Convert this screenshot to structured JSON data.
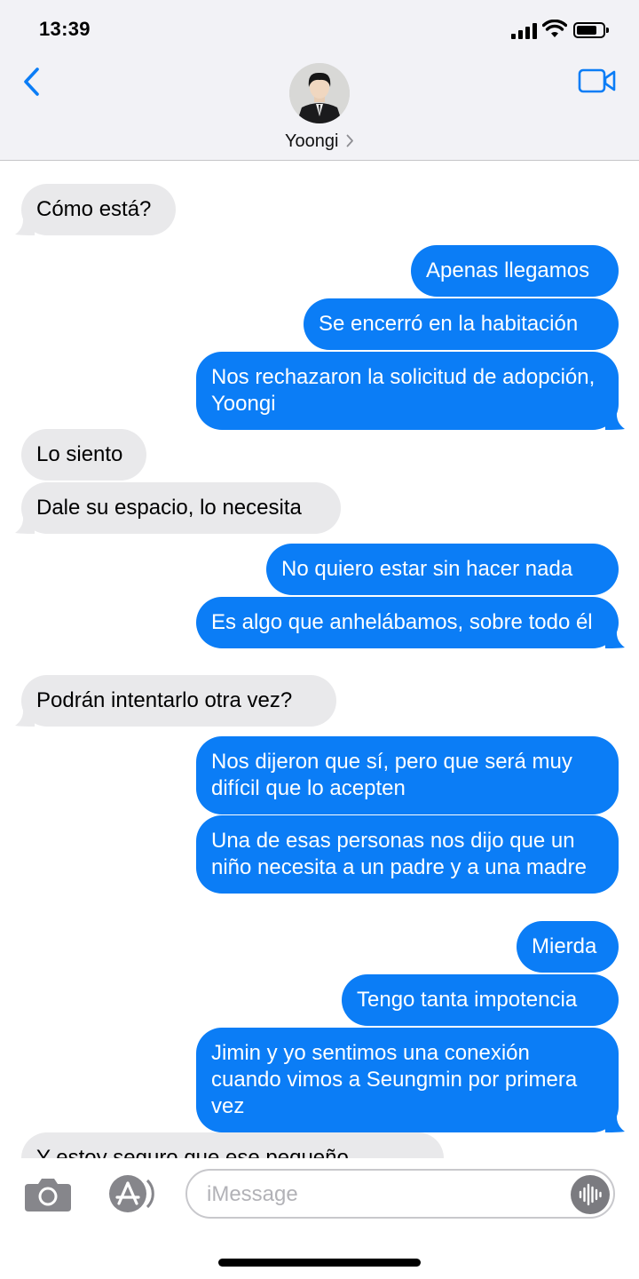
{
  "status_bar": {
    "time": "13:39"
  },
  "header": {
    "contact_name": "Yoongi",
    "back_icon": "chevron-left-icon",
    "video_icon": "video-camera-icon",
    "accent_color": "#0b7df6"
  },
  "messages": [
    {
      "direction": "received",
      "text": "Cómo está?"
    },
    {
      "direction": "sent",
      "text": "Apenas llegamos"
    },
    {
      "direction": "sent",
      "text": "Se encerró en la habitación"
    },
    {
      "direction": "sent",
      "text": "Nos rechazaron la solicitud de adopción, Yoongi"
    },
    {
      "direction": "received",
      "text": "Lo siento"
    },
    {
      "direction": "received",
      "text": "Dale su espacio, lo necesita"
    },
    {
      "direction": "sent",
      "text": "No quiero estar sin hacer nada"
    },
    {
      "direction": "sent",
      "text": "Es algo que anhelábamos, sobre todo él"
    },
    {
      "direction": "received",
      "text": "Podrán intentarlo otra vez?"
    },
    {
      "direction": "sent",
      "text": "Nos dijeron que sí, pero que será muy difícil que lo acepten"
    },
    {
      "direction": "sent",
      "text": "Una de esas personas nos dijo que un niño necesita a un padre y a una madre"
    },
    {
      "direction": "sent",
      "text": "Mierda"
    },
    {
      "direction": "sent",
      "text": "Tengo tanta impotencia"
    },
    {
      "direction": "sent",
      "text": "Jimin y yo sentimos una conexión cuando vimos a Seungmin por primera vez"
    },
    {
      "direction": "received",
      "text": "Y estoy seguro que ese pequeño"
    }
  ],
  "composer": {
    "placeholder": "iMessage",
    "camera_icon": "camera-icon",
    "appstore_icon": "app-store-icon",
    "audio_icon": "audio-waveform-icon"
  },
  "colors": {
    "sent_bubble": "#0b7df6",
    "received_bubble": "#e9e9eb",
    "header_bg": "#f2f2f6"
  }
}
